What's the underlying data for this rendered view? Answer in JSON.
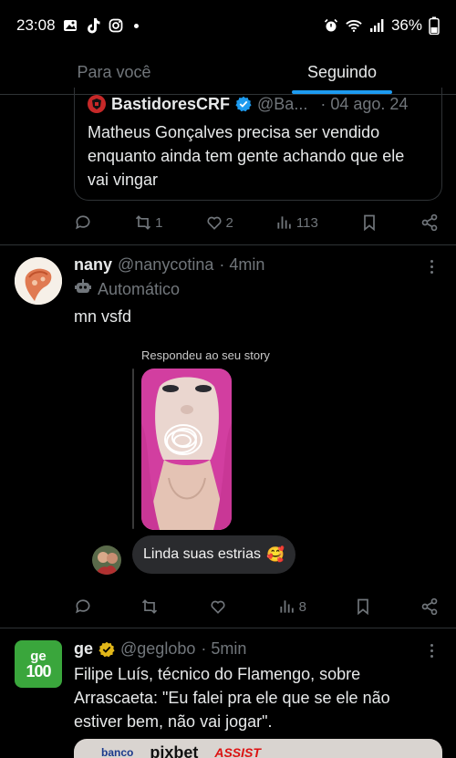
{
  "status_bar": {
    "time": "23:08",
    "battery": "36%"
  },
  "tabs": [
    {
      "label": "Para você"
    },
    {
      "label": "Seguindo"
    }
  ],
  "quote": {
    "name": "BastidoresCRF",
    "handle": "@Ba...",
    "date": "· 04 ago. 24",
    "text": "Matheus Gonçalves precisa ser vendido enquanto ainda tem gente achando que ele vai vingar"
  },
  "actions_1": {
    "reposts": "1",
    "likes": "2",
    "views": "113"
  },
  "tweet_nany": {
    "name": "nany",
    "handle": "@nanycotina",
    "time": "· 4min",
    "automatic_label": "Automático",
    "text": "mn vsfd",
    "story_caption": "Respondeu ao seu story",
    "reply_text": "Linda suas estrias",
    "reply_emoji": "🥰"
  },
  "actions_2": {
    "reposts": "",
    "likes": "",
    "views": "8"
  },
  "tweet_ge": {
    "name": "ge",
    "handle": "@geglobo",
    "time": "· 5min",
    "avatar_line1": "ge",
    "avatar_line2": "100",
    "text": "Filipe Luís, técnico do Flamengo, sobre Arrascaeta: \"Eu falei pra ele que se ele não estiver bem, não vai jogar\".",
    "media_text_1": "banco",
    "media_text_2": "pixbet",
    "media_text_3": "ASSIST"
  },
  "colors": {
    "accent": "#1d9bf0",
    "muted": "#71767b",
    "divider": "#2f3336",
    "verified_gold": "#e2b719"
  }
}
